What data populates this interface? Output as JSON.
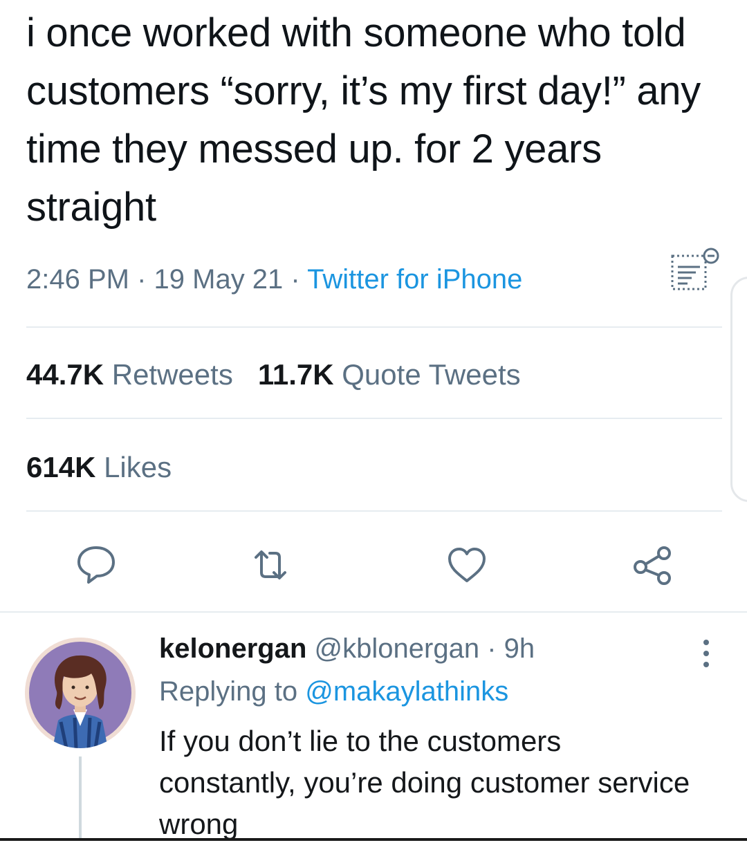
{
  "tweet": {
    "text": "i once worked with someone who told customers “sorry, it’s my first day!” any time they messed up. for 2 years straight",
    "time": "2:46 PM",
    "date": "19 May 21",
    "separator": " · ",
    "source": "Twitter for iPhone"
  },
  "stats": {
    "retweets_count": "44.7K",
    "retweets_label": " Retweets",
    "quotes_count": "11.7K",
    "quotes_label": " Quote Tweets",
    "likes_count": "614K",
    "likes_label": " Likes"
  },
  "actions": [
    "reply-icon",
    "retweet-icon",
    "like-icon",
    "share-icon"
  ],
  "reply": {
    "name": "kelonergan",
    "handle": "@kblonergan",
    "time_sep": " · ",
    "time": "9h",
    "replying_label": "Replying to ",
    "replying_to": "@makaylathinks",
    "text": "If you don’t lie to the customers constantly, you’re doing customer service wrong"
  },
  "colors": {
    "link": "#1b95e0",
    "secondary_text": "#5b7083",
    "primary_text": "#14171a",
    "divider": "#e6ecf0"
  }
}
